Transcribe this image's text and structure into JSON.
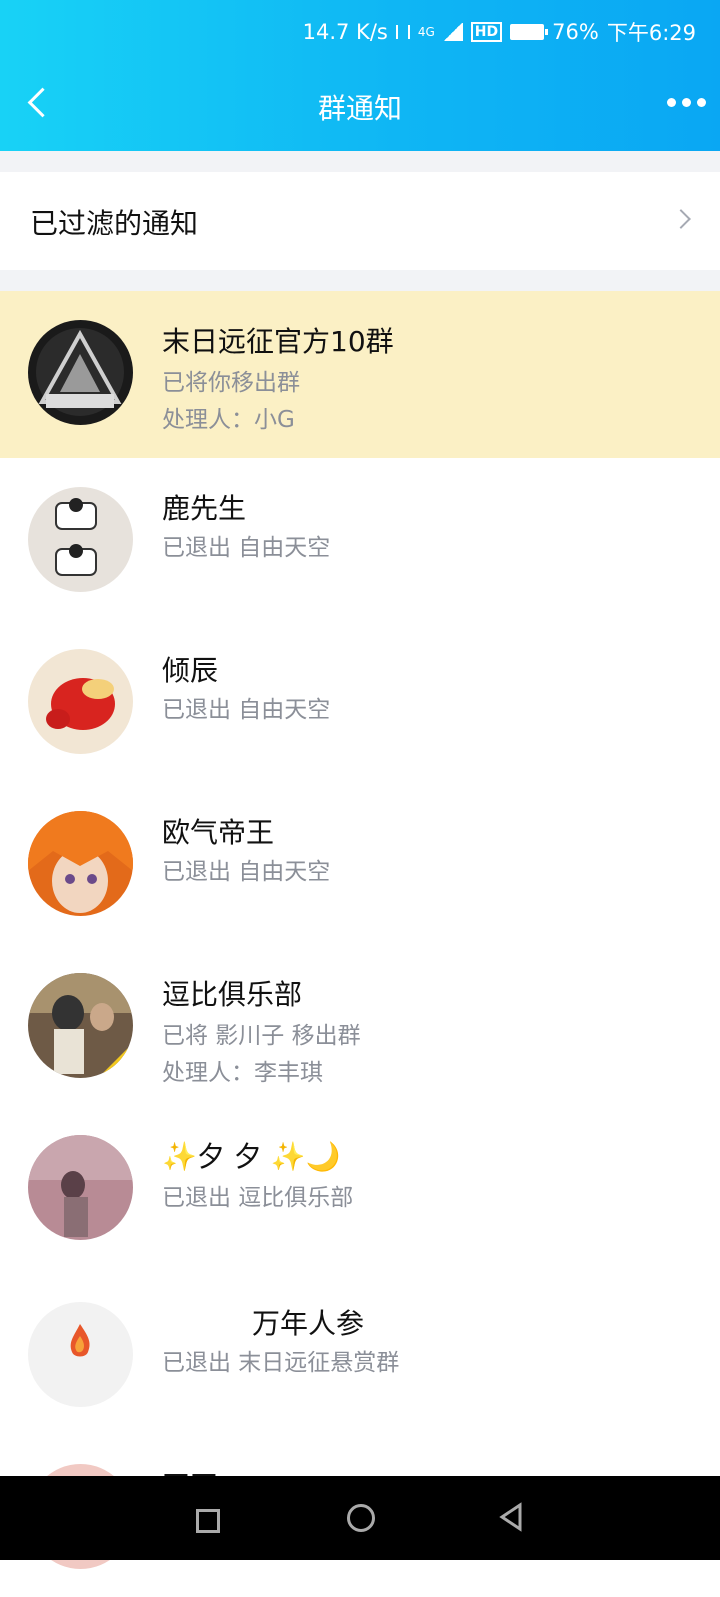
{
  "status_bar": {
    "net_speed": "14.7 K/s",
    "network": "4G",
    "hd_label": "HD",
    "battery": "76%",
    "time": "下午6:29"
  },
  "header": {
    "title": "群通知",
    "back_icon": "chevron-left-icon",
    "more_icon": "more-dots-icon"
  },
  "filtered": {
    "label": "已过滤的通知",
    "icon": "chevron-right-icon"
  },
  "notifications": [
    {
      "name": "末日远征官方10群",
      "line1": "已将你移出群",
      "line2": "处理人：小G",
      "highlighted": true
    },
    {
      "name": "鹿先生",
      "line1": "已退出 自由天空"
    },
    {
      "name": "倾辰",
      "line1": "已退出 自由天空"
    },
    {
      "name": "欧气帝王",
      "line1": "已退出 自由天空"
    },
    {
      "name": "逗比俱乐部",
      "line1": "已将 影川子 移出群",
      "line2": "处理人：李丰琪"
    },
    {
      "name": "✨夕 夕 ✨🌙",
      "line1": "已退出 逗比俱乐部"
    },
    {
      "name": "万年人参",
      "line1": "已退出 末日远征悬赏群"
    },
    {
      "name": "四四",
      "line1": ""
    }
  ],
  "nav": {
    "recent_icon": "square-icon",
    "home_icon": "circle-icon",
    "back_icon": "triangle-back-icon"
  }
}
